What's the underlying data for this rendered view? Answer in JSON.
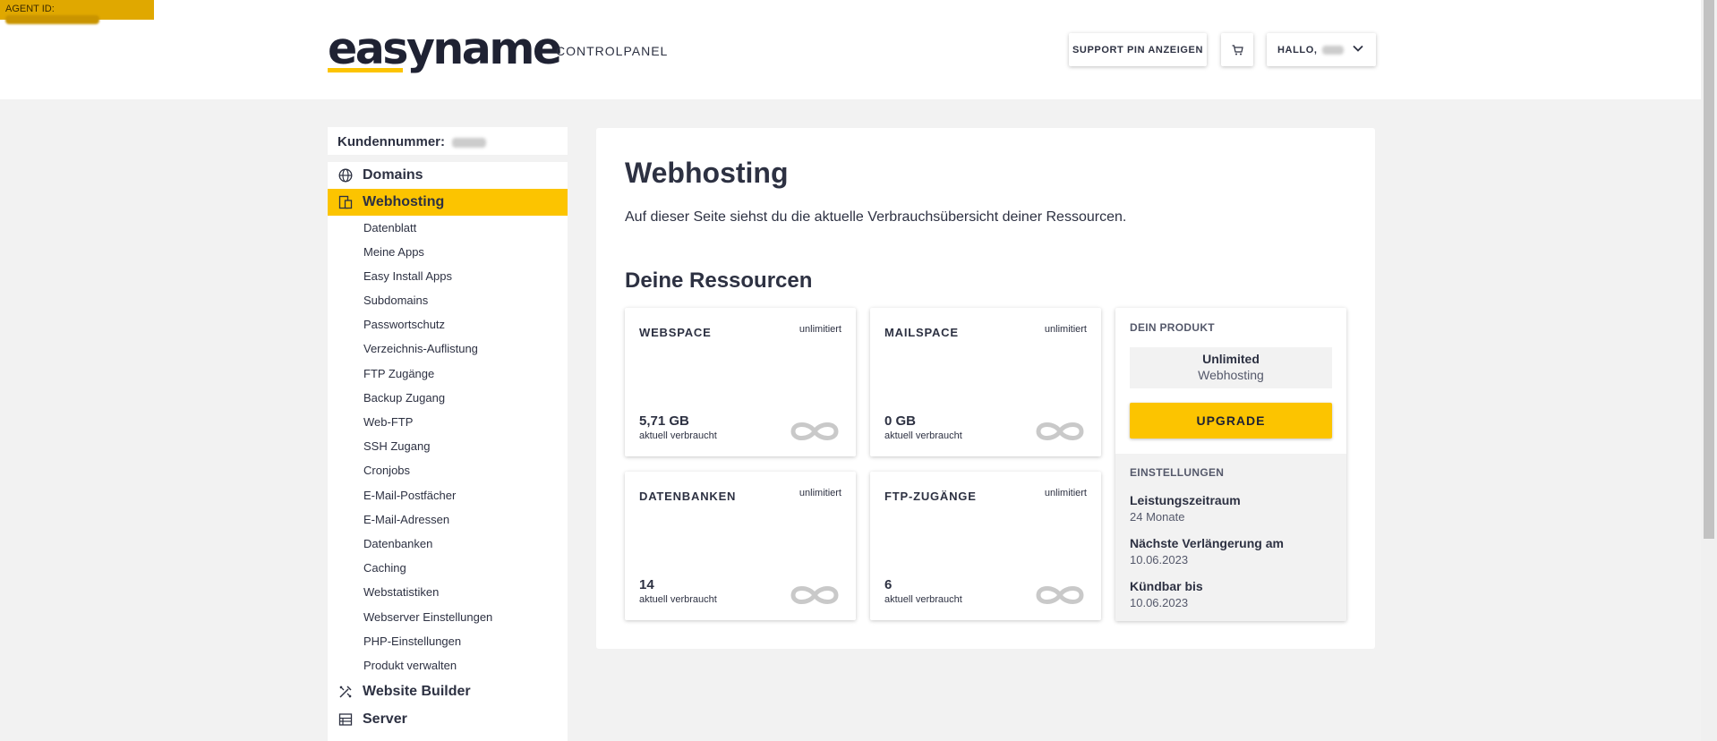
{
  "agent": {
    "label": "AGENT ID:"
  },
  "header": {
    "logo": "easyname",
    "subtitle": "CONTROLPANEL",
    "support_button": "SUPPORT PIN ANZEIGEN",
    "user_greeting": "HALLO,",
    "cart_icon": "cart-icon"
  },
  "sidebar": {
    "customer_label": "Kundennummer:",
    "domains": "Domains",
    "webhosting": "Webhosting",
    "sub_items": [
      "Datenblatt",
      "Meine Apps",
      "Easy Install Apps",
      "Subdomains",
      "Passwortschutz",
      "Verzeichnis-Auflistung",
      "FTP Zugänge",
      "Backup Zugang",
      "Web-FTP",
      "SSH Zugang",
      "Cronjobs",
      "E-Mail-Postfächer",
      "E-Mail-Adressen",
      "Datenbanken",
      "Caching",
      "Webstatistiken",
      "Webserver Einstellungen",
      "PHP-Einstellungen",
      "Produkt verwalten"
    ],
    "website_builder": "Website Builder",
    "server": "Server"
  },
  "main": {
    "title": "Webhosting",
    "description": "Auf dieser Seite siehst du die aktuelle Verbrauchsübersicht deiner Ressourcen.",
    "section_title": "Deine Ressourcen",
    "resources": [
      {
        "name": "WEBSPACE",
        "limit": "unlimitiert",
        "value": "5,71 GB",
        "used_label": "aktuell verbraucht"
      },
      {
        "name": "MAILSPACE",
        "limit": "unlimitiert",
        "value": "0 GB",
        "used_label": "aktuell verbraucht"
      },
      {
        "name": "DATENBANKEN",
        "limit": "unlimitiert",
        "value": "14",
        "used_label": "aktuell verbraucht"
      },
      {
        "name": "FTP-ZUGÄNGE",
        "limit": "unlimitiert",
        "value": "6",
        "used_label": "aktuell verbraucht"
      }
    ],
    "product": {
      "label": "DEIN PRODUKT",
      "name": "Unlimited",
      "type": "Webhosting",
      "upgrade": "UPGRADE"
    },
    "settings": {
      "label": "EINSTELLUNGEN",
      "items": [
        {
          "key": "Leistungszeitraum",
          "value": "24 Monate"
        },
        {
          "key": "Nächste Verlängerung am",
          "value": "10.06.2023"
        },
        {
          "key": "Kündbar bis",
          "value": "10.06.2023"
        }
      ]
    }
  },
  "colors": {
    "accent": "#fcc400",
    "text": "#2d3142",
    "background": "#f2f2f2"
  }
}
